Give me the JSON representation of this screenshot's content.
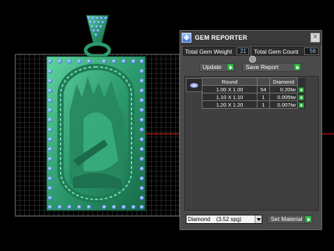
{
  "window": {
    "title": "GEM REPORTER",
    "close_glyph": "✕",
    "icon": "gem-reporter-app-icon"
  },
  "totals": {
    "weight_label": "Total Gem Weight",
    "weight_value": "21",
    "count_label": "Total Gem Count",
    "count_value": "56"
  },
  "actions": {
    "update_label": "Update",
    "save_report_label": "Save Report"
  },
  "gem_table": {
    "headers": [
      "Round",
      "",
      "Diamond"
    ],
    "rows": [
      {
        "size": "1.00 X 1.00",
        "count": "54",
        "weight": "0.20tw"
      },
      {
        "size": "1.10 X 1.10",
        "count": "1",
        "weight": "0.005tw"
      },
      {
        "size": "1.20 X 1.20",
        "count": "1",
        "weight": "0.007tw"
      }
    ]
  },
  "material": {
    "selected": "Diamond    (3.52 spg)",
    "set_label": "Set Material"
  },
  "colors": {
    "panel_bg": "#4a4a4a",
    "value_text": "#86c6ff",
    "go_button": "#3bb54a",
    "model_green": "#2fa075",
    "gem_dots": "#7aa6ff",
    "axis_red": "#ff2020"
  }
}
